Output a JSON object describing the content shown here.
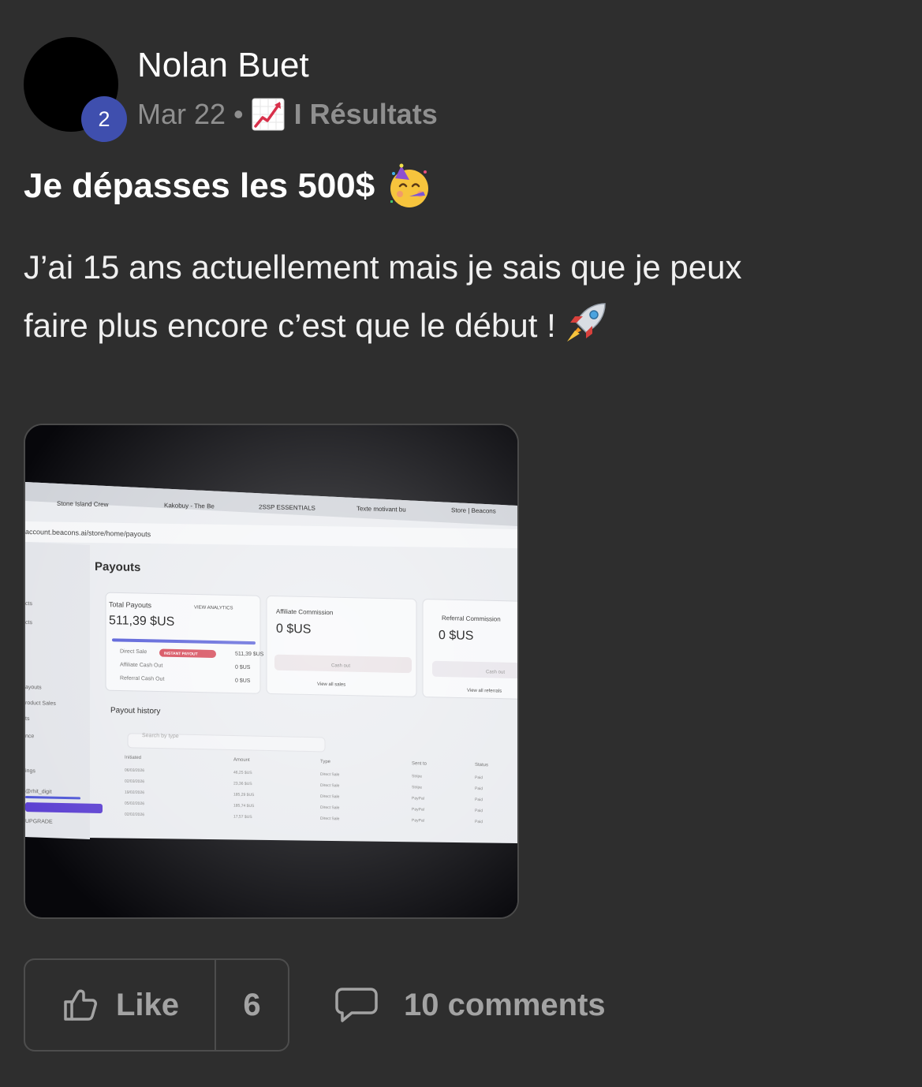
{
  "author": {
    "name": "Nolan Buet",
    "level": "2"
  },
  "meta": {
    "date": "Mar 22",
    "separator": "•",
    "category_icon": "chart-increasing-emoji",
    "category": "I Résultats"
  },
  "post": {
    "title": "Je dépasses les 500$",
    "title_emoji": "partying-face-emoji",
    "body_line1": "J’ai 15 ans actuellement mais je sais que je peux",
    "body_line2": "faire plus encore c’est que le début !",
    "body_emoji": "rocket-emoji"
  },
  "attachment": {
    "browser": {
      "tabs": [
        "Stone Island Crew",
        "Kakobuy - The Be",
        "2SSP ESSENTIALS",
        "Texte motivant bu",
        "Store | Beacons"
      ],
      "url": "account.beacons.ai/store/home/payouts"
    },
    "sidebar_items": [
      "cts",
      "cts",
      "ayouts",
      "roduct Sales",
      "ts",
      "nce",
      "ings",
      "@rhit_digit",
      "UPGRADE"
    ],
    "page_title": "Payouts",
    "total_payouts": {
      "label": "Total Payouts",
      "link": "VIEW ANALYTICS",
      "value": "511,39 $US",
      "rows": [
        {
          "label": "Direct Sale",
          "badge": "INSTANT PAYOUT",
          "value": "511,39 $US"
        },
        {
          "label": "Affiliate Cash Out",
          "value": "0 $US"
        },
        {
          "label": "Referral Cash Out",
          "value": "0 $US"
        }
      ]
    },
    "affiliate": {
      "label": "Affiliate Commission",
      "value": "0 $US",
      "button": "Cash out",
      "link": "View all sales"
    },
    "referral": {
      "label": "Referral Commission",
      "value": "0 $US",
      "button": "Cash out",
      "link": "View all referrals"
    },
    "history": {
      "title": "Payout history",
      "search_placeholder": "Search by type",
      "columns": [
        "Initiated",
        "Amount",
        "Type",
        "Sent to",
        "Status"
      ],
      "rows": [
        [
          "06/03/2026",
          "46,25 $US",
          "Direct Sale",
          "Stripe",
          "Paid"
        ],
        [
          "02/03/2026",
          "23,36 $US",
          "Direct Sale",
          "Stripe",
          "Paid"
        ],
        [
          "19/02/2026",
          "185,29 $US",
          "Direct Sale",
          "PayPal",
          "Paid"
        ],
        [
          "05/02/2026",
          "185,74 $US",
          "Direct Sale",
          "PayPal",
          "Paid"
        ],
        [
          "02/02/2026",
          "17,57 $US",
          "Direct Sale",
          "PayPal",
          "Paid"
        ]
      ]
    }
  },
  "actions": {
    "like_label": "Like",
    "like_count": "6",
    "comments_label": "10 comments"
  }
}
